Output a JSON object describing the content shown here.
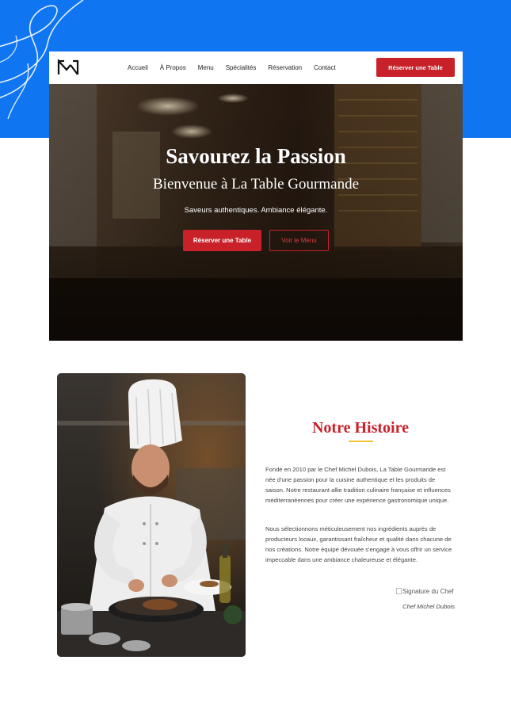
{
  "colors": {
    "background_accent": "#0f75f0",
    "brand_red": "#c8212a",
    "gold_accent": "#f0c33a"
  },
  "nav": {
    "logo_icon": "monogram-logo-icon",
    "links": [
      "Accueil",
      "À Propos",
      "Menu",
      "Spécialités",
      "Réservation",
      "Contact"
    ],
    "cta_label": "Réserver une Table"
  },
  "hero": {
    "title": "Savourez la Passion",
    "subtitle": "Bienvenue à La Table Gourmande",
    "tagline": "Saveurs authentiques. Ambiance élégante.",
    "primary_button": "Réserver une Table",
    "secondary_button": "Voir le Menu",
    "background_image": "restaurant-interior-photo"
  },
  "about": {
    "image": "chef-cooking-photo",
    "title": "Notre Histoire",
    "paragraph_1": "Fondé en 2010 par le Chef Michel Dubois, La Table Gourmande est née d'une passion pour la cuisine authentique et les produits de saison. Notre restaurant allie tradition culinaire française et influences méditerranéennes pour créer une expérience gastronomique unique.",
    "paragraph_2": "Nous sélectionnons méticuleusement nos ingrédients auprès de producteurs locaux, garantissant fraîcheur et qualité dans chacune de nos créations. Notre équipe dévouée s'engage à vous offrir un service impeccable dans une ambiance chaleureuse et élégante.",
    "signature_alt": "Signature du Chef",
    "chef_name": "Chef Michel Dubois"
  }
}
